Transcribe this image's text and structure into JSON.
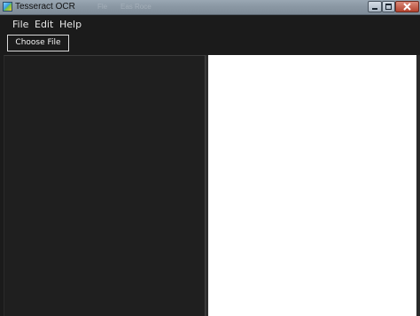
{
  "window": {
    "title": "Tesseract OCR",
    "background_faint_texts": [
      "Fle",
      "Eas Roce"
    ]
  },
  "title_controls": {
    "minimize_icon": "minimize-icon",
    "maximize_icon": "maximize-icon",
    "close_icon": "close-icon"
  },
  "menu": {
    "items": [
      {
        "label": "File"
      },
      {
        "label": "Edit"
      },
      {
        "label": "Help"
      }
    ]
  },
  "toolbar": {
    "choose_file_label": "Choose File"
  },
  "colors": {
    "menu_bg": "#1b1b1b",
    "left_pane_bg": "#1f1f1f",
    "right_pane_bg": "#ffffff",
    "menu_text": "#e8e8e8",
    "button_border": "#d8d8d8"
  }
}
